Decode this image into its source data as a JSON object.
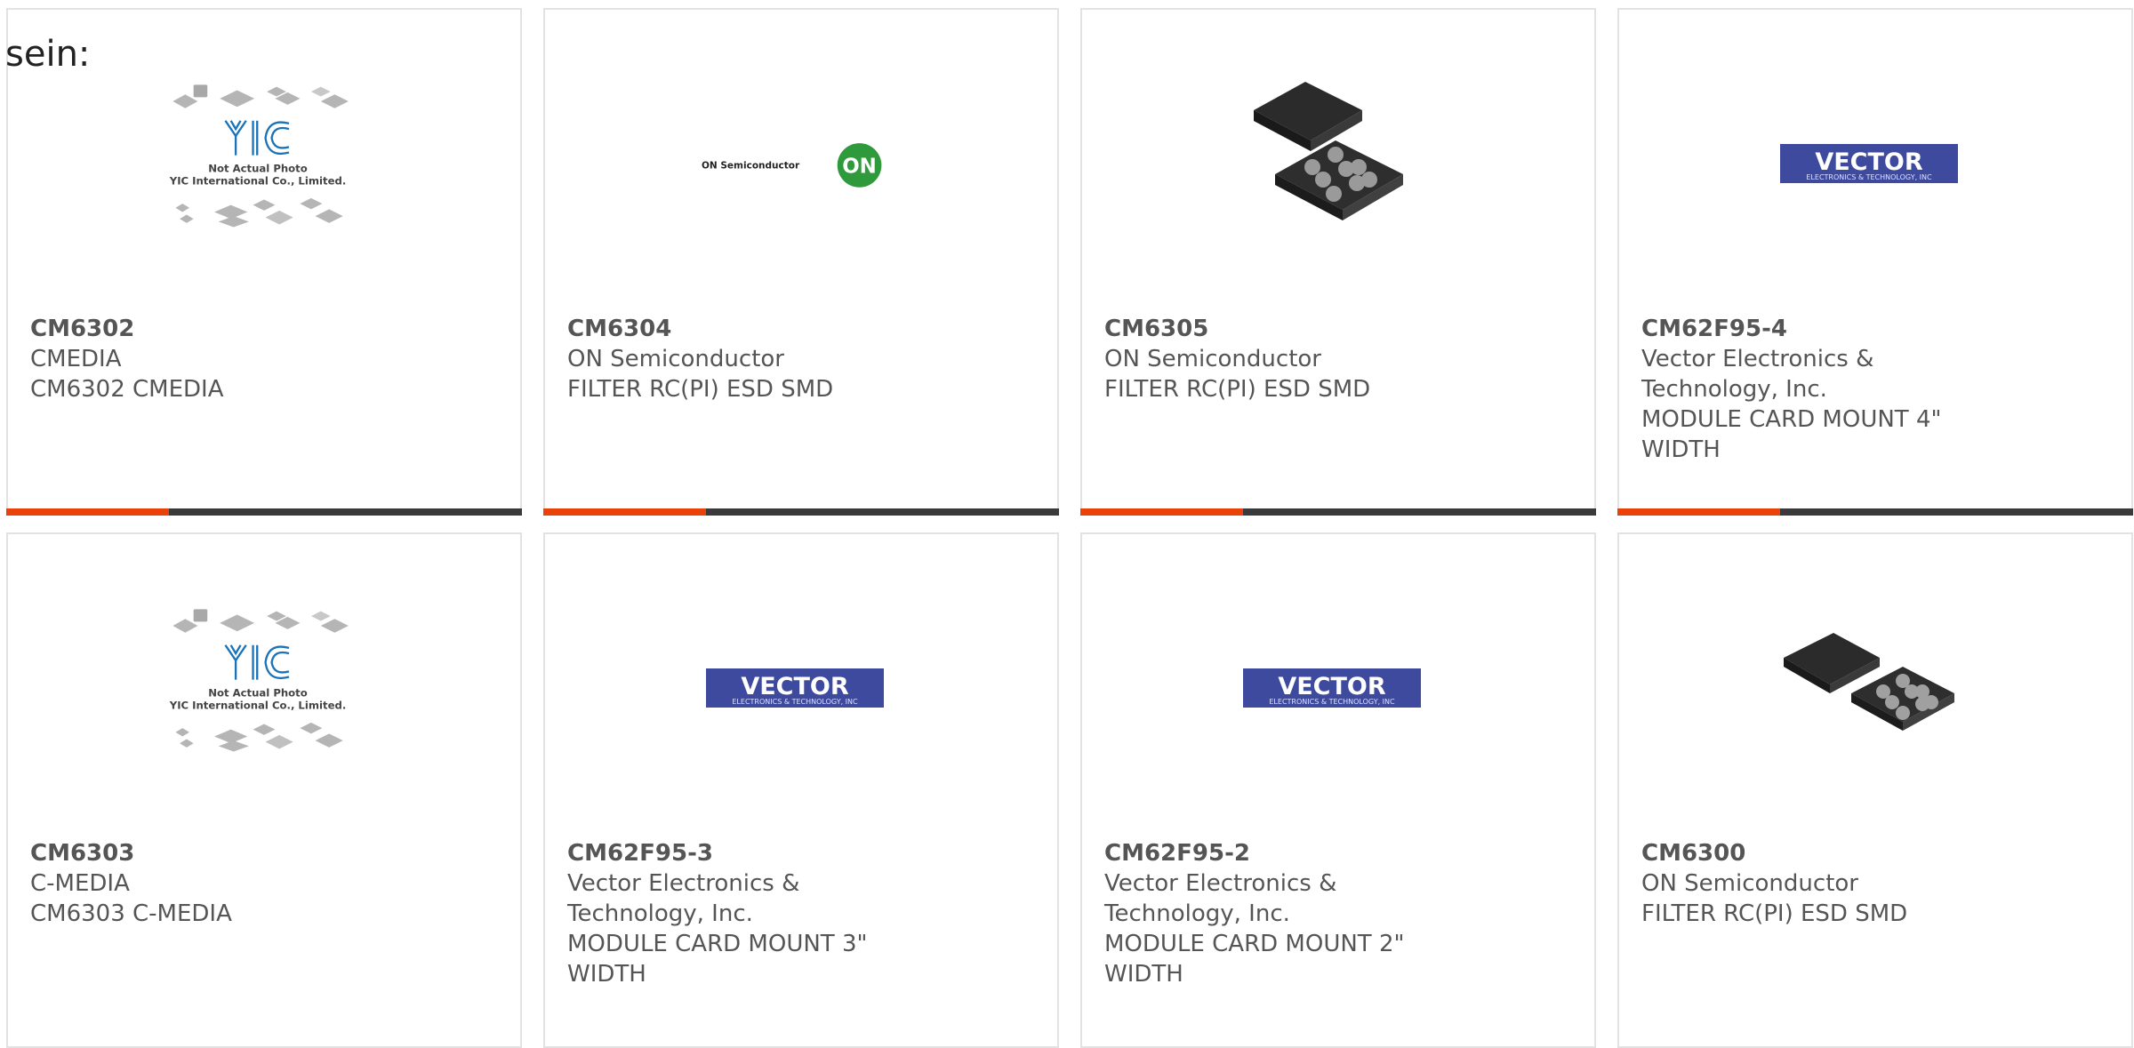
{
  "intro_text": "sein:",
  "products": [
    {
      "part": "CM6302",
      "manufacturer": "CMEDIA",
      "description": "CM6302 CMEDIA",
      "image": "yic-placeholder",
      "accent_color": "#e8420a"
    },
    {
      "part": "CM6304",
      "manufacturer": "ON Semiconductor",
      "description": "FILTER RC(PI) ESD SMD",
      "image": "on-semiconductor-logo",
      "accent_color": "#e8420a"
    },
    {
      "part": "CM6305",
      "manufacturer": "ON Semiconductor",
      "description": "FILTER RC(PI) ESD SMD",
      "image": "bga-chip-photo",
      "accent_color": "#e8420a"
    },
    {
      "part": "CM62F95-4",
      "manufacturer": "Vector Electronics & Technology, Inc.",
      "description": "MODULE CARD MOUNT 4\" WIDTH",
      "image": "vector-logo",
      "accent_color": "#e8420a"
    },
    {
      "part": "CM6303",
      "manufacturer": "C-MEDIA",
      "description": "CM6303 C-MEDIA",
      "image": "yic-placeholder",
      "accent_color": "#e8420a"
    },
    {
      "part": "CM62F95-3",
      "manufacturer": "Vector Electronics & Technology, Inc.",
      "description": "MODULE CARD MOUNT 3\" WIDTH",
      "image": "vector-logo",
      "accent_color": "#e8420a"
    },
    {
      "part": "CM62F95-2",
      "manufacturer": "Vector Electronics & Technology, Inc.",
      "description": "MODULE CARD MOUNT 2\" WIDTH",
      "image": "vector-logo",
      "accent_color": "#e8420a"
    },
    {
      "part": "CM6300",
      "manufacturer": "ON Semiconductor",
      "description": "FILTER RC(PI) ESD SMD",
      "image": "bga-chip-photo",
      "accent_color": "#e8420a"
    }
  ],
  "placeholder": {
    "brand": "YIC",
    "line1": "Not Actual Photo",
    "line2": "YIC International Co., Limited."
  },
  "on_logo": {
    "wordmark": "ON Semiconductor",
    "badge": "ON"
  },
  "vector_logo": {
    "wordmark": "VECTOR",
    "tagline": "ELECTRONICS & TECHNOLOGY, INC"
  }
}
